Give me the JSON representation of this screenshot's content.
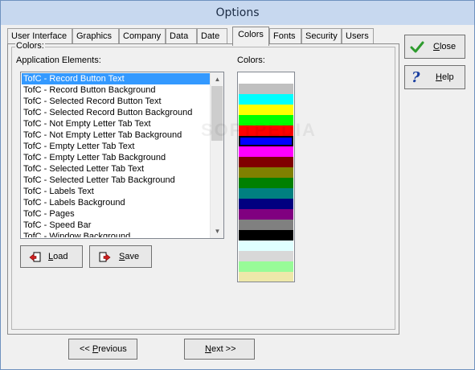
{
  "window": {
    "title": "Options"
  },
  "tabs": [
    {
      "label": "User Interface"
    },
    {
      "label": "Graphics"
    },
    {
      "label": "Company"
    },
    {
      "label": "Data"
    },
    {
      "label": "Date"
    },
    {
      "label": "Colors",
      "active": true
    },
    {
      "label": "Fonts"
    },
    {
      "label": "Security"
    },
    {
      "label": "Users"
    }
  ],
  "colors_panel": {
    "group_label": "Colors:",
    "elements_label": "Application Elements:",
    "colors_label": "Colors:",
    "elements": [
      "TofC - Record Button Text",
      "TofC - Record Button Background",
      "TofC - Selected Record Button Text",
      "TofC - Selected Record Button Background",
      "TofC - Not Empty Letter Tab Text",
      "TofC - Not Empty Letter Tab Background",
      "TofC - Empty Letter Tab Text",
      "TofC - Empty Letter Tab Background",
      "TofC - Selected Letter Tab Text",
      "TofC - Selected Letter Tab Background",
      "TofC - Labels Text",
      "TofC - Labels Background",
      "TofC - Pages",
      "TofC - Speed Bar",
      "TofC - Window Background"
    ],
    "selected_index": 0,
    "swatches": [
      "#ffffff",
      "#c0c0c0",
      "#00ffff",
      "#ffff00",
      "#00ff00",
      "#ff0000",
      "#0000ff",
      "#ff00ff",
      "#800000",
      "#808000",
      "#008000",
      "#008080",
      "#000080",
      "#800080",
      "#808080",
      "#000000",
      "#e0ffff",
      "#d8d8d8",
      "#98fb98",
      "#eee8aa"
    ],
    "outlined_swatch_index": 6,
    "load_button": {
      "label": "Load",
      "accel": "L"
    },
    "save_button": {
      "label": "Save",
      "accel": "S"
    }
  },
  "side_buttons": {
    "close": {
      "label": "Close",
      "accel": "C"
    },
    "help": {
      "label": "Help",
      "accel": "H"
    }
  },
  "nav_buttons": {
    "previous": {
      "prefix": "<< ",
      "accel": "P",
      "rest": "revious"
    },
    "next": {
      "accel": "N",
      "rest": "ext >>"
    }
  },
  "colors": {
    "accent_selection": "#3399ff",
    "close_check": "#2e9b2e",
    "help_mark": "#1a3fa0"
  }
}
